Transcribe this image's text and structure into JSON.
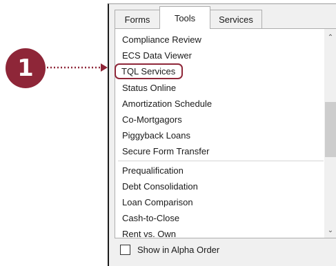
{
  "callout": {
    "number": "1"
  },
  "tabs": [
    "Forms",
    "Tools",
    "Services"
  ],
  "active_tab": "Tools",
  "list": {
    "items_top": [
      "Compliance Review",
      "ECS Data Viewer",
      "TQL Services",
      "Status Online",
      "Amortization Schedule",
      "Co-Mortgagors",
      "Piggyback Loans",
      "Secure Form Transfer"
    ],
    "items_bottom": [
      "Prequalification",
      "Debt Consolidation",
      "Loan Comparison",
      "Cash-to-Close",
      "Rent vs. Own"
    ],
    "highlighted_item": "TQL Services"
  },
  "scrollbar": {
    "up_icon": "chevron-up-icon",
    "down_icon": "chevron-down-icon"
  },
  "footer": {
    "checkbox_label": "Show in Alpha Order",
    "checked": false
  },
  "colors": {
    "accent": "#8e2638"
  }
}
